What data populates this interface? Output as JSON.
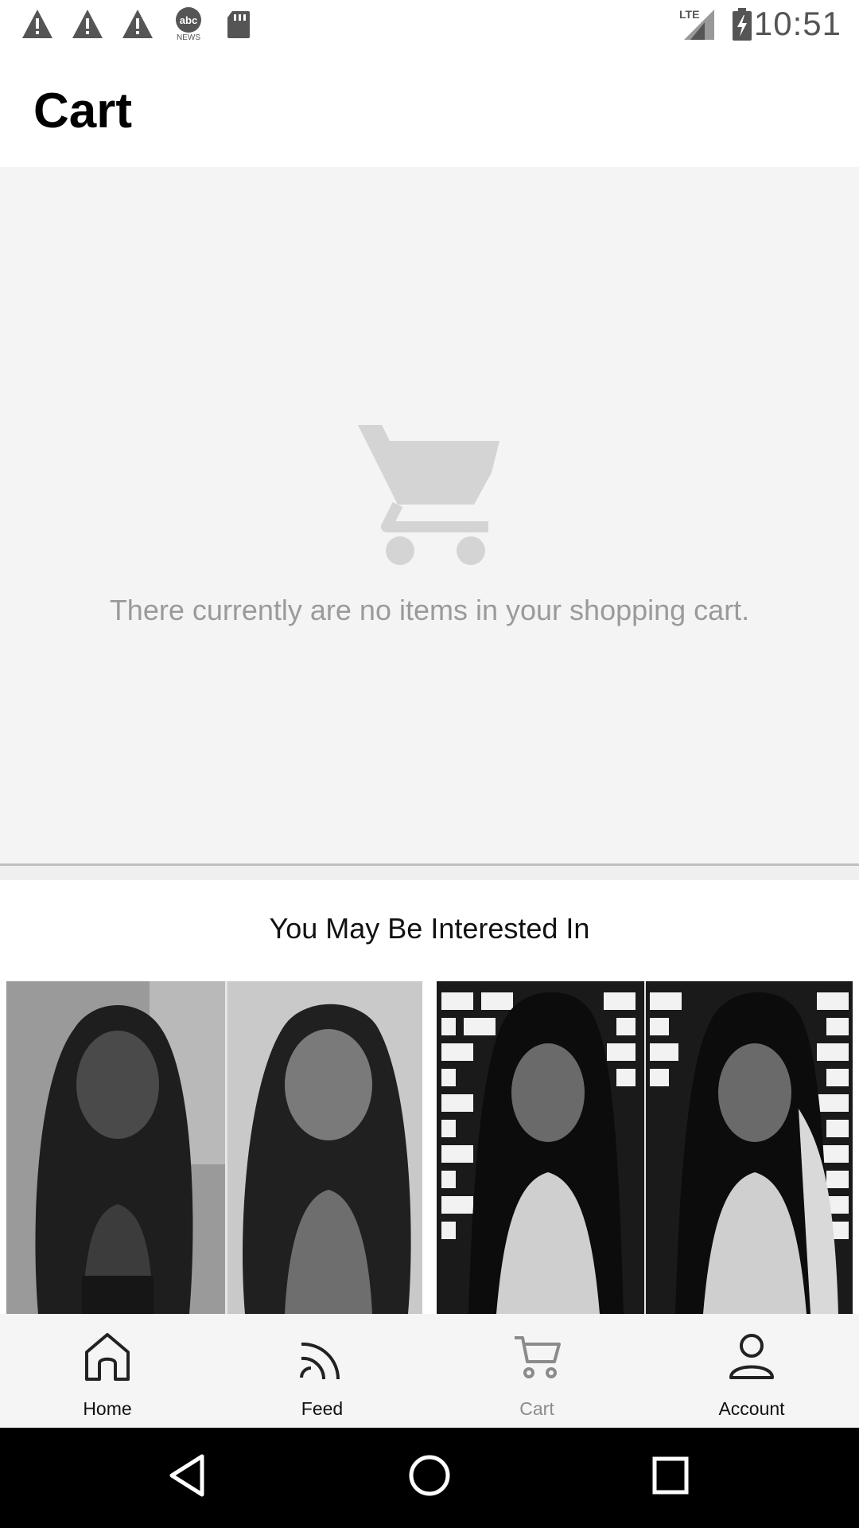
{
  "status_bar": {
    "time": "10:51",
    "left_icons": [
      "warning-icon",
      "warning-icon",
      "warning-icon",
      "abc-news-icon",
      "sd-card-icon"
    ],
    "right_icons": [
      "lte-signal-icon",
      "battery-charging-icon"
    ],
    "news_label": "NEWS",
    "lte_label": "LTE"
  },
  "header": {
    "title": "Cart"
  },
  "empty_state": {
    "icon": "cart-icon",
    "message": "There currently are no items in your shopping cart."
  },
  "recommendations": {
    "title": "You May Be Interested In"
  },
  "bottom_nav": {
    "items": [
      {
        "label": "Home",
        "icon": "home-icon",
        "active": false
      },
      {
        "label": "Feed",
        "icon": "feed-icon",
        "active": false
      },
      {
        "label": "Cart",
        "icon": "cart-icon",
        "active": true
      },
      {
        "label": "Account",
        "icon": "account-icon",
        "active": false
      }
    ]
  },
  "system_nav": {
    "buttons": [
      "back-icon",
      "home-circle-icon",
      "recents-icon"
    ]
  },
  "colors": {
    "empty_background": "#f4f4f4",
    "muted_text": "#9a9a9a",
    "nav_active": "#8b8b8b",
    "system_bar": "#000000"
  }
}
